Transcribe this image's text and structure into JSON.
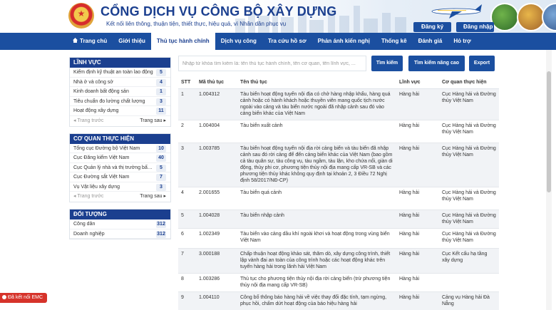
{
  "header": {
    "title": "CỔNG DỊCH VỤ CÔNG BỘ XÂY DỰNG",
    "subtitle": "Kết nối liên thông, thuận tiện, thiết thực, hiệu quả, vì Nhân dân phục vụ",
    "register_label": "Đăng ký",
    "login_label": "Đăng nhập"
  },
  "nav": {
    "items": [
      {
        "label": "Trang chủ"
      },
      {
        "label": "Giới thiệu"
      },
      {
        "label": "Thủ tục hành chính"
      },
      {
        "label": "Dịch vụ công"
      },
      {
        "label": "Tra cứu hồ sơ"
      },
      {
        "label": "Phản ánh kiến nghị"
      },
      {
        "label": "Thống kê"
      },
      {
        "label": "Đánh giá"
      },
      {
        "label": "Hỏ trợ"
      }
    ]
  },
  "sidebar": {
    "linh_vuc": {
      "title": "LĨNH VỰC",
      "items": [
        {
          "label": "Kiểm định kỹ thuật an toàn lao động",
          "count": "5"
        },
        {
          "label": "Nhà ở và công sở",
          "count": "4"
        },
        {
          "label": "Kinh doanh bất động sản",
          "count": "1"
        },
        {
          "label": "Tiêu chuẩn đo lường chất lượng",
          "count": "3"
        },
        {
          "label": "Hoạt động xây dựng",
          "count": "11"
        }
      ],
      "prev": "Trang trước",
      "next": "Trang sau"
    },
    "co_quan": {
      "title": "CƠ QUAN THỰC HIỆN",
      "items": [
        {
          "label": "Tổng cục Đường bộ Việt Nam",
          "count": "10"
        },
        {
          "label": "Cục Đăng kiểm Việt Nam",
          "count": "40"
        },
        {
          "label": "Cục Quản lý nhà và thị trường bất động...",
          "count": "5"
        },
        {
          "label": "Cục Đường sắt Việt Nam",
          "count": "7"
        },
        {
          "label": "Vụ Vật liệu xây dựng",
          "count": "3"
        }
      ],
      "prev": "Trang trước",
      "next": "Trang sau"
    },
    "doi_tuong": {
      "title": "ĐỐI TƯỢNG",
      "items": [
        {
          "label": "Công dân",
          "count": "312"
        },
        {
          "label": "Doanh nghiệp",
          "count": "312"
        }
      ]
    }
  },
  "search": {
    "placeholder": "Nhập từ khóa tìm kiếm là: tên thủ tục hành chính, tên cơ quan, tên lĩnh vực, ...",
    "search_label": "Tìm kiếm",
    "advanced_label": "Tìm kiếm nâng cao",
    "export_label": "Export"
  },
  "table": {
    "headers": [
      "STT",
      "Mã thủ tục",
      "Tên thủ tục",
      "Lĩnh vực",
      "Cơ quan thực hiện"
    ],
    "rows": [
      {
        "stt": "1",
        "ma": "1.004312",
        "ten": "Tàu biển hoạt động tuyến nội địa có chở hàng nhập khẩu, hàng quá cảnh hoặc có hành khách hoặc thuyền viên mang quốc tịch nước ngoài vào cảng và tàu biển nước ngoài đã nhập cảnh sau đó vào cảng biển khác của Việt Nam",
        "linh_vuc": "Hàng hải",
        "co_quan": "Cục Hàng hải và Đường thủy Việt Nam"
      },
      {
        "stt": "2",
        "ma": "1.004004",
        "ten": "Tàu biển xuất cảnh",
        "linh_vuc": "Hàng hải",
        "co_quan": "Cục Hàng hải và Đường thủy Việt Nam"
      },
      {
        "stt": "3",
        "ma": "1.003785",
        "ten": "Tàu biển hoạt động tuyến nội địa rời cảng biển và tàu biển đã nhập cảnh sau đó rời cảng để đến cảng biển khác của Việt Nam (bao gồm cả tàu quân sự, tàu công vụ, tàu ngầm, tàu lặn, kho chứa nổi, giàn di động, thủy phi cơ, phương tiện thủy nội địa mang cấp VR-SB và các phương tiện thủy khác không quy định tại khoản 2, 3 Điều 72 Nghị định 58/2017/NĐ-CP)",
        "linh_vuc": "Hàng hải",
        "co_quan": "Cục Hàng hải và Đường thủy Việt Nam"
      },
      {
        "stt": "4",
        "ma": "2.001655",
        "ten": "Tàu biển quá cảnh",
        "linh_vuc": "Hàng hải",
        "co_quan": "Cục Hàng hải và Đường thủy Việt Nam"
      },
      {
        "stt": "5",
        "ma": "1.004028",
        "ten": "Tàu biển nhập cảnh",
        "linh_vuc": "Hàng hải",
        "co_quan": "Cục Hàng hải và Đường thủy Việt Nam"
      },
      {
        "stt": "6",
        "ma": "1.002349",
        "ten": "Tàu biển vào cảng dầu khí ngoài khơi và hoạt động trong vùng biển Việt Nam",
        "linh_vuc": "Hàng hải",
        "co_quan": "Cục Hàng hải và Đường thủy Việt Nam"
      },
      {
        "stt": "7",
        "ma": "3.000188",
        "ten": "Chấp thuận hoạt động khảo sát, thăm dò, xây dựng công trình, thiết lập vành đai an toàn của công trình hoặc các hoạt động khác trên tuyến hàng hải trong lãnh hải Việt Nam",
        "linh_vuc": "Hàng hải",
        "co_quan": "Cục Kết cấu hạ tầng xây dựng"
      },
      {
        "stt": "8",
        "ma": "1.003286",
        "ten": "Thủ tục cho phương tiện thủy nội địa rời cảng biển (trừ phương tiện thủy nội địa mang cấp VR-SB)",
        "linh_vuc": "Hàng hải",
        "co_quan": ""
      },
      {
        "stt": "9",
        "ma": "1.004110",
        "ten": "Công bố thông báo hàng hải về việc thay đổi đặc tính, tạm ngừng, phục hồi, chấm dứt hoạt động của báo hiệu hàng hải",
        "linh_vuc": "Hàng hải",
        "co_quan": "Cảng vụ Hàng hải Đà Nẵng"
      }
    ]
  },
  "emc": {
    "label": "Đã kết nối EMC"
  },
  "colors": {
    "primary": "#1b4fa0",
    "title": "#1b3f8f",
    "emc": "#d6332a"
  }
}
